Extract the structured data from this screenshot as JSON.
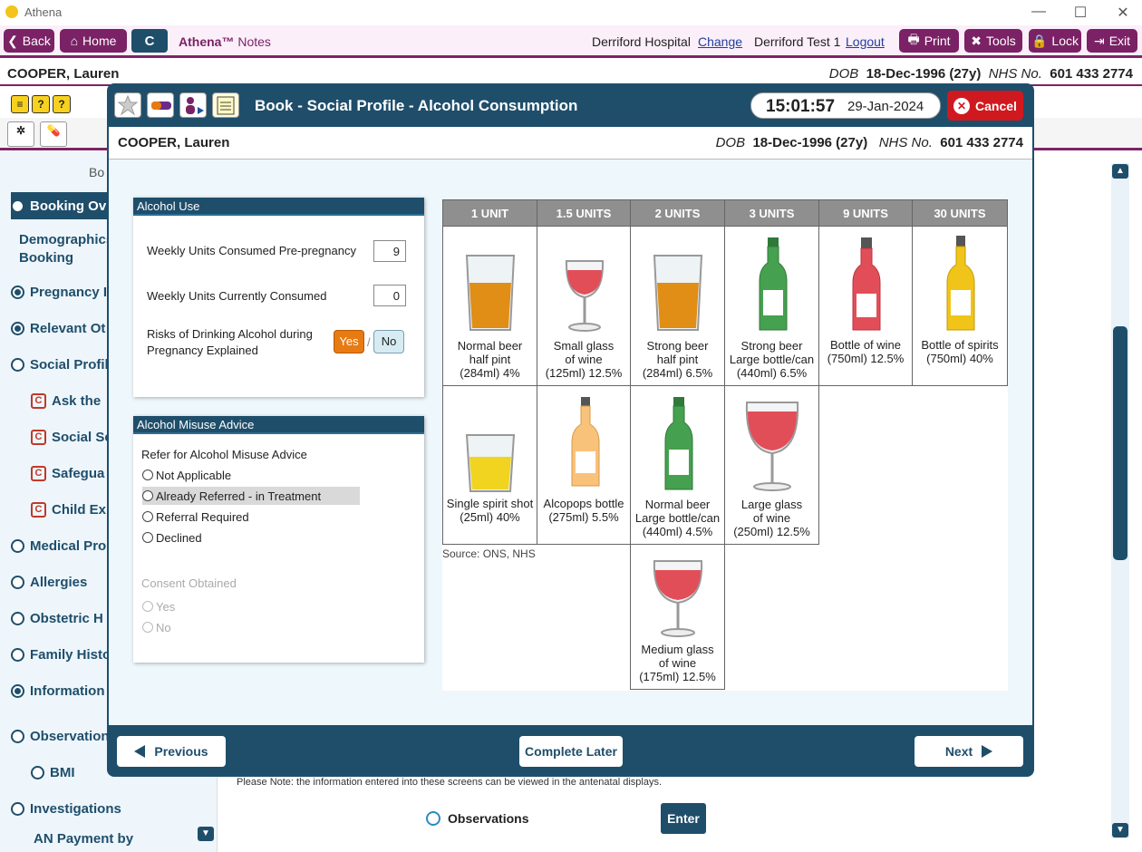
{
  "window": {
    "title": "Athena"
  },
  "nav": {
    "back": "Back",
    "home": "Home",
    "c": "C",
    "brand": "Athena™",
    "brand_sub": "Notes",
    "hospital": "Derriford Hospital",
    "change": "Change",
    "user": "Derriford Test 1",
    "logout": "Logout",
    "print": "Print",
    "tools": "Tools",
    "lock": "Lock",
    "exit": "Exit"
  },
  "patient": {
    "name": "COOPER, Lauren",
    "dob_label": "DOB",
    "dob": "18-Dec-1996 (27y)",
    "nhs_label": "NHS No.",
    "nhs": "601 433 2774"
  },
  "sidebar": {
    "header": "Bo",
    "items": [
      {
        "label": "Booking Ov"
      },
      {
        "label": "Demographics"
      },
      {
        "label": "Booking"
      },
      {
        "label": "Pregnancy I"
      },
      {
        "label": "Relevant Ot"
      },
      {
        "label": "Social Profil"
      },
      {
        "label": "Ask the"
      },
      {
        "label": "Social Se"
      },
      {
        "label": "Safegua"
      },
      {
        "label": "Child Ex"
      },
      {
        "label": "Medical Pro"
      },
      {
        "label": "Allergies"
      },
      {
        "label": "Obstetric H"
      },
      {
        "label": "Family Histo"
      },
      {
        "label": "Information"
      },
      {
        "label": "Observation"
      },
      {
        "label": "BMI"
      },
      {
        "label": "Investigations"
      },
      {
        "label": "AN Payment by"
      }
    ]
  },
  "modal": {
    "title": "Book - Social Profile - Alcohol Consumption",
    "time": "15:01:57",
    "date": "29-Jan-2024",
    "cancel": "Cancel"
  },
  "alcohol_use": {
    "title": "Alcohol Use",
    "pre_label": "Weekly Units Consumed Pre-pregnancy",
    "pre_value": "9",
    "current_label": "Weekly Units Currently Consumed",
    "current_value": "0",
    "risks_label_1": "Risks of Drinking Alcohol during",
    "risks_label_2": "Pregnancy Explained",
    "yes": "Yes",
    "sep": "/",
    "no": "No"
  },
  "misuse": {
    "title": "Alcohol Misuse Advice",
    "refer_label": "Refer for Alcohol Misuse Advice",
    "options": [
      "Not Applicable",
      "Already Referred - in Treatment",
      "Referral Required",
      "Declined"
    ],
    "consent_label": "Consent Obtained",
    "consent_options": [
      "Yes",
      "No"
    ]
  },
  "units": {
    "headers": [
      "1 UNIT",
      "1.5 UNITS",
      "2 UNITS",
      "3 UNITS",
      "9 UNITS",
      "30 UNITS"
    ],
    "row1": [
      [
        "Normal beer",
        "half pint",
        "(284ml) 4%"
      ],
      [
        "Small glass",
        "of wine",
        "(125ml) 12.5%"
      ],
      [
        "Strong beer",
        "half pint",
        "(284ml) 6.5%"
      ],
      [
        "Strong beer",
        "Large bottle/can",
        "(440ml) 6.5%"
      ],
      [
        "Bottle of wine",
        "(750ml) 12.5%",
        ""
      ],
      [
        "Bottle of spirits",
        "(750ml) 40%",
        ""
      ]
    ],
    "row2": [
      [
        "Single spirit shot",
        "(25ml) 40%",
        ""
      ],
      [
        "Alcopops bottle",
        "(275ml) 5.5%",
        ""
      ],
      [
        "Normal beer",
        "Large bottle/can",
        "(440ml) 4.5%"
      ],
      [
        "Large glass",
        "of wine",
        "(250ml) 12.5%"
      ]
    ],
    "row3": [
      [
        "Medium glass",
        "of wine",
        "(175ml) 12.5%"
      ]
    ],
    "source": "Source: ONS, NHS"
  },
  "footer": {
    "previous": "Previous",
    "later": "Complete Later",
    "next": "Next"
  },
  "background": {
    "note": "Please Note: the information entered into these screens can be viewed in the antenatal displays.",
    "observations": "Observations",
    "enter": "Enter"
  },
  "colors": {
    "accent": "#7a2265",
    "primary": "#1f4e6b",
    "cancel": "#d0191f",
    "yes": "#e87a12"
  }
}
